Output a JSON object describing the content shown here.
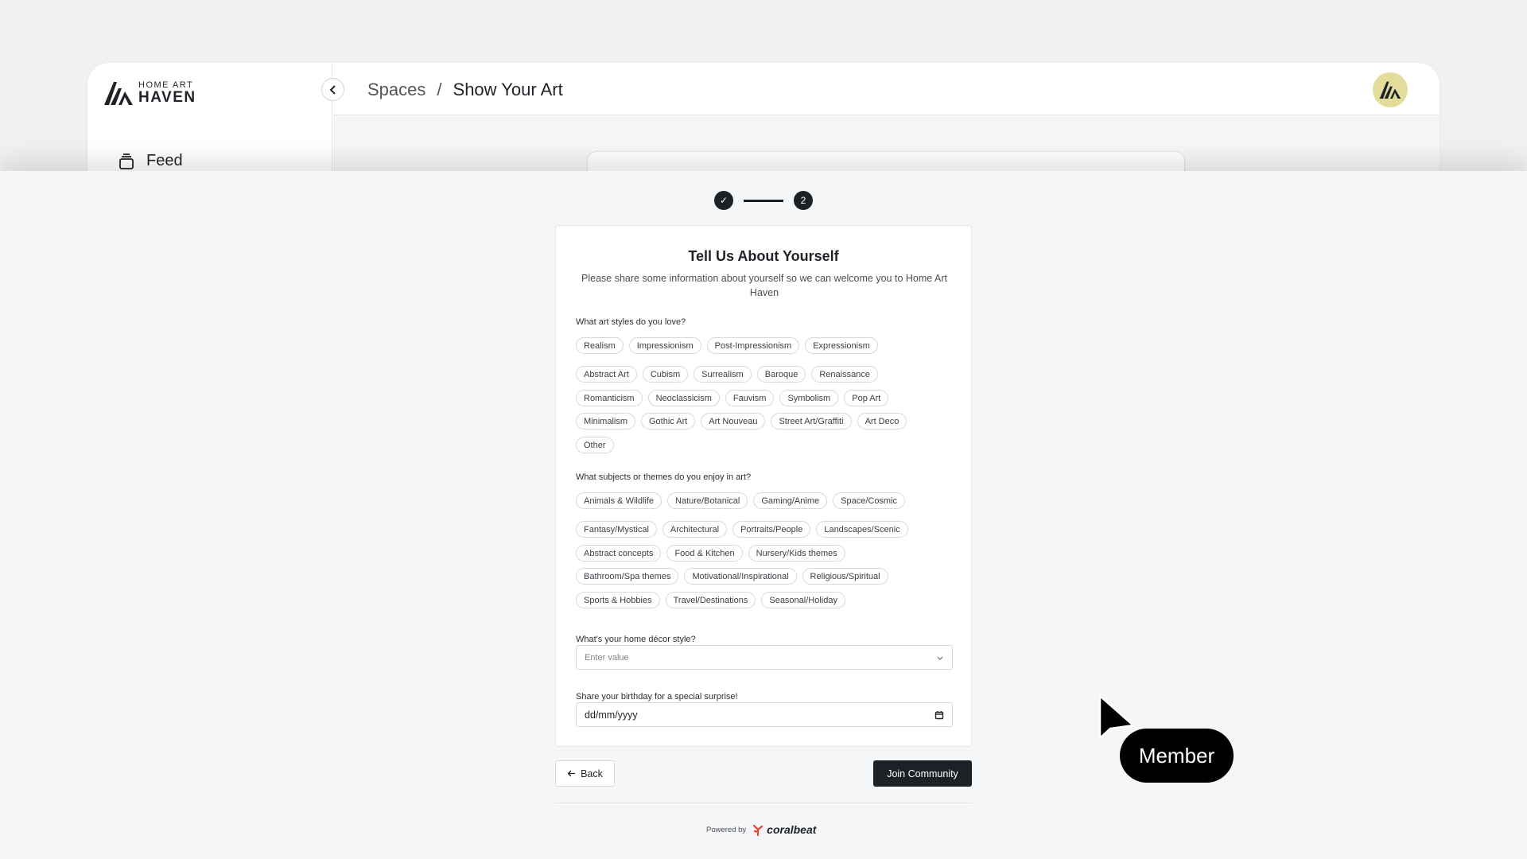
{
  "app": {
    "logo_top": "HOME ART",
    "logo_bottom": "HAVEN",
    "sidebar_feed": "Feed",
    "breadcrumb_parent": "Spaces",
    "breadcrumb_sep": "/",
    "breadcrumb_current": "Show Your Art"
  },
  "onboarding": {
    "steps": [
      {
        "label": "✓",
        "state": "done"
      },
      {
        "label": "2",
        "state": "current"
      }
    ],
    "title": "Tell Us About Yourself",
    "subtitle": "Please share some information about yourself so we can welcome you to Home Art Haven",
    "art_styles": {
      "label": "What art styles do you love?",
      "rows": [
        [
          "Realism",
          "Impressionism",
          "Post-Impressionism",
          "Expressionism"
        ],
        [
          "Abstract Art",
          "Cubism",
          "Surrealism",
          "Baroque",
          "Renaissance"
        ],
        [
          "Romanticism",
          "Neoclassicism",
          "Fauvism",
          "Symbolism",
          "Pop Art"
        ],
        [
          "Minimalism",
          "Gothic Art",
          "Art Nouveau",
          "Street Art/Graffiti",
          "Art Deco"
        ],
        [
          "Other"
        ]
      ]
    },
    "subjects": {
      "label": "What subjects or themes do you enjoy in art?",
      "rows": [
        [
          "Animals & Wildlife",
          "Nature/Botanical",
          "Gaming/Anime",
          "Space/Cosmic"
        ],
        [
          "Fantasy/Mystical",
          "Architectural",
          "Portraits/People",
          "Landscapes/Scenic"
        ],
        [
          "Abstract concepts",
          "Food & Kitchen",
          "Nursery/Kids themes"
        ],
        [
          "Bathroom/Spa themes",
          "Motivational/Inspirational",
          "Religious/Spiritual"
        ],
        [
          "Sports & Hobbies",
          "Travel/Destinations",
          "Seasonal/Holiday"
        ]
      ]
    },
    "decor": {
      "label": "What's your home décor style?",
      "placeholder": "Enter value"
    },
    "birthday": {
      "label": "Share your birthday for a special surprise!",
      "value": "dd/mm/yyyy"
    },
    "back_label": "Back",
    "join_label": "Join Community",
    "powered_label": "Powered by",
    "brand_label": "coralbeat"
  },
  "cursor_tag": "Member",
  "colors": {
    "primary_dark": "#1c2128",
    "avatar_bg": "#e4dc9b",
    "brand_accent": "#e8452c"
  }
}
